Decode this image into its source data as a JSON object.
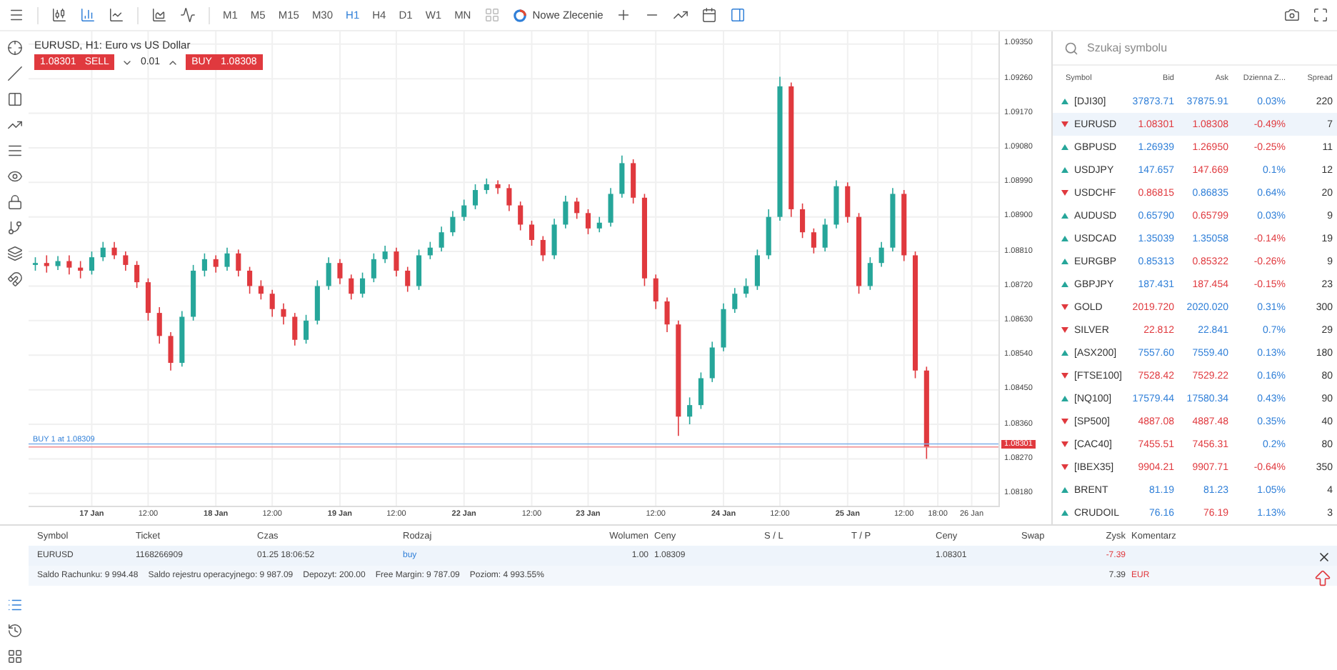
{
  "toolbar": {
    "timeframes": [
      {
        "label": "M1",
        "selected": false
      },
      {
        "label": "M5",
        "selected": false
      },
      {
        "label": "M15",
        "selected": false
      },
      {
        "label": "M30",
        "selected": false
      },
      {
        "label": "H1",
        "selected": true
      },
      {
        "label": "H4",
        "selected": false
      },
      {
        "label": "D1",
        "selected": false
      },
      {
        "label": "W1",
        "selected": false
      },
      {
        "label": "MN",
        "selected": false
      }
    ],
    "new_order": "Nowe Zlecenie"
  },
  "chart": {
    "title": "EURUSD, H1: Euro vs US Dollar",
    "sell": {
      "price": "1.08301",
      "label": "SELL"
    },
    "lot": "0.01",
    "buy": {
      "label": "BUY",
      "price": "1.08308"
    },
    "order_line": "BUY 1 at 1.08309",
    "current_price": "1.08301",
    "chart_data": {
      "type": "candlestick",
      "categories": [
        null,
        null,
        null,
        null,
        null,
        "17 Jan",
        null,
        null,
        null,
        null,
        "12:00",
        null,
        null,
        null,
        null,
        null,
        "18 Jan",
        null,
        null,
        null,
        null,
        "12:00",
        null,
        null,
        null,
        null,
        null,
        "19 Jan",
        null,
        null,
        null,
        null,
        "12:00",
        null,
        null,
        null,
        null,
        null,
        "22 Jan",
        null,
        null,
        null,
        null,
        null,
        "12:00",
        null,
        null,
        null,
        null,
        "23 Jan",
        null,
        null,
        null,
        null,
        null,
        "12:00",
        null,
        null,
        null,
        null,
        null,
        "24 Jan",
        null,
        null,
        null,
        null,
        "12:00",
        null,
        null,
        null,
        null,
        null,
        "25 Jan",
        null,
        null,
        null,
        null,
        "12:00",
        null,
        null,
        "18:00",
        null,
        null,
        "26 Jan"
      ],
      "ohlc": [
        [
          1.08775,
          1.08795,
          1.0876,
          1.0878
        ],
        [
          1.0878,
          1.088,
          1.08755,
          1.08772
        ],
        [
          1.08772,
          1.08798,
          1.08762,
          1.08785
        ],
        [
          1.08785,
          1.088,
          1.0875,
          1.08768
        ],
        [
          1.08768,
          1.08785,
          1.0874,
          1.0876
        ],
        [
          1.0876,
          1.0881,
          1.0875,
          1.08795
        ],
        [
          1.08795,
          1.08835,
          1.08785,
          1.0882
        ],
        [
          1.0882,
          1.08835,
          1.0879,
          1.088
        ],
        [
          1.088,
          1.0881,
          1.0876,
          1.08775
        ],
        [
          1.08775,
          1.08785,
          1.08715,
          1.0873
        ],
        [
          1.0873,
          1.0874,
          1.0863,
          1.0865
        ],
        [
          1.0865,
          1.08665,
          1.0857,
          1.0859
        ],
        [
          1.0859,
          1.086,
          1.085,
          1.0852
        ],
        [
          1.0852,
          1.08655,
          1.0851,
          1.0864
        ],
        [
          1.0864,
          1.08775,
          1.0863,
          1.0876
        ],
        [
          1.0876,
          1.08805,
          1.08745,
          1.0879
        ],
        [
          1.0879,
          1.088,
          1.08755,
          1.0877
        ],
        [
          1.0877,
          1.0882,
          1.0876,
          1.08805
        ],
        [
          1.08805,
          1.08815,
          1.08745,
          1.0876
        ],
        [
          1.0876,
          1.0877,
          1.087,
          1.0872
        ],
        [
          1.0872,
          1.08735,
          1.08685,
          1.087
        ],
        [
          1.087,
          1.0871,
          1.0864,
          1.0866
        ],
        [
          1.0866,
          1.08675,
          1.0862,
          1.0864
        ],
        [
          1.0864,
          1.0865,
          1.08565,
          1.0858
        ],
        [
          1.0858,
          1.08645,
          1.0857,
          1.0863
        ],
        [
          1.0863,
          1.08735,
          1.0862,
          1.0872
        ],
        [
          1.0872,
          1.08795,
          1.0871,
          1.0878
        ],
        [
          1.0878,
          1.0879,
          1.08725,
          1.0874
        ],
        [
          1.0874,
          1.0875,
          1.08685,
          1.087
        ],
        [
          1.087,
          1.08755,
          1.0869,
          1.0874
        ],
        [
          1.0874,
          1.08805,
          1.0873,
          1.0879
        ],
        [
          1.0879,
          1.08825,
          1.0878,
          1.0881
        ],
        [
          1.0881,
          1.0882,
          1.08745,
          1.0876
        ],
        [
          1.0876,
          1.0877,
          1.08705,
          1.0872
        ],
        [
          1.0872,
          1.08815,
          1.0871,
          1.088
        ],
        [
          1.088,
          1.08835,
          1.0879,
          1.0882
        ],
        [
          1.0882,
          1.08875,
          1.0881,
          1.0886
        ],
        [
          1.0886,
          1.08915,
          1.0885,
          1.089
        ],
        [
          1.089,
          1.08945,
          1.0889,
          1.0893
        ],
        [
          1.0893,
          1.08985,
          1.0892,
          1.0897
        ],
        [
          1.0897,
          1.09,
          1.0896,
          1.08985
        ],
        [
          1.08985,
          1.08995,
          1.0896,
          1.08975
        ],
        [
          1.08975,
          1.08985,
          1.08915,
          1.0893
        ],
        [
          1.0893,
          1.0894,
          1.08865,
          1.0888
        ],
        [
          1.0888,
          1.0889,
          1.08825,
          1.0884
        ],
        [
          1.0884,
          1.0885,
          1.08785,
          1.088
        ],
        [
          1.088,
          1.08895,
          1.0879,
          1.0888
        ],
        [
          1.0888,
          1.08955,
          1.0887,
          1.0894
        ],
        [
          1.0894,
          1.0895,
          1.08895,
          1.0891
        ],
        [
          1.0891,
          1.0892,
          1.08855,
          1.0887
        ],
        [
          1.0887,
          1.089,
          1.0886,
          1.08885
        ],
        [
          1.08885,
          1.08975,
          1.08875,
          1.0896
        ],
        [
          1.0896,
          1.0906,
          1.0895,
          1.0904
        ],
        [
          1.0904,
          1.0905,
          1.08935,
          1.0895
        ],
        [
          1.0895,
          1.0896,
          1.0872,
          1.0874
        ],
        [
          1.0874,
          1.0875,
          1.0866,
          1.0868
        ],
        [
          1.0868,
          1.0869,
          1.086,
          1.0862
        ],
        [
          1.0862,
          1.0863,
          1.0833,
          1.0838
        ],
        [
          1.0838,
          1.0843,
          1.0836,
          1.0841
        ],
        [
          1.0841,
          1.08495,
          1.084,
          1.0848
        ],
        [
          1.0848,
          1.08575,
          1.0847,
          1.0856
        ],
        [
          1.0856,
          1.08675,
          1.0855,
          1.0866
        ],
        [
          1.0866,
          1.08715,
          1.0865,
          1.087
        ],
        [
          1.087,
          1.0874,
          1.0869,
          1.0872
        ],
        [
          1.0872,
          1.08815,
          1.0871,
          1.088
        ],
        [
          1.088,
          1.0892,
          1.0879,
          1.089
        ],
        [
          1.089,
          1.09265,
          1.0889,
          1.0924
        ],
        [
          1.0924,
          1.0925,
          1.089,
          1.0892
        ],
        [
          1.0892,
          1.08935,
          1.08845,
          1.0886
        ],
        [
          1.0886,
          1.0887,
          1.08805,
          1.0882
        ],
        [
          1.0882,
          1.08895,
          1.0881,
          1.0888
        ],
        [
          1.0888,
          1.08995,
          1.0887,
          1.0898
        ],
        [
          1.0898,
          1.0899,
          1.08885,
          1.089
        ],
        [
          1.089,
          1.0891,
          1.087,
          1.0872
        ],
        [
          1.0872,
          1.08795,
          1.0871,
          1.0878
        ],
        [
          1.0878,
          1.08835,
          1.0877,
          1.0882
        ],
        [
          1.0882,
          1.08975,
          1.0881,
          1.0896
        ],
        [
          1.0896,
          1.0897,
          1.08785,
          1.088
        ],
        [
          1.088,
          1.0881,
          1.0848,
          1.085
        ],
        [
          1.085,
          1.0851,
          1.0827,
          1.083
        ],
        null,
        null,
        null,
        null
      ],
      "grid": true,
      "ref_lines": [
        {
          "axis": "y",
          "value": 1.08309,
          "color": "#7fb0ea"
        },
        {
          "axis": "y",
          "value": 1.08301,
          "color": "#f08a8d"
        }
      ],
      "ylim": [
        1.08148,
        1.09383
      ],
      "yticks": [
        {
          "value": 1.0935,
          "label": "1.09350"
        },
        {
          "value": 1.0926,
          "label": "1.09260"
        },
        {
          "value": 1.0917,
          "label": "1.09170"
        },
        {
          "value": 1.0908,
          "label": "1.09080"
        },
        {
          "value": 1.0899,
          "label": "1.08990"
        },
        {
          "value": 1.089,
          "label": "1.08900"
        },
        {
          "value": 1.0881,
          "label": "1.08810"
        },
        {
          "value": 1.0872,
          "label": "1.08720"
        },
        {
          "value": 1.0863,
          "label": "1.08630"
        },
        {
          "value": 1.0854,
          "label": "1.08540"
        },
        {
          "value": 1.0845,
          "label": "1.08450"
        },
        {
          "value": 1.0836,
          "label": "1.08360"
        },
        {
          "value": 1.0827,
          "label": "1.08270"
        },
        {
          "value": 1.0818,
          "label": "1.08180"
        }
      ]
    }
  },
  "watchlist": {
    "placeholder": "Szukaj symbolu",
    "columns": [
      "Symbol",
      "Bid",
      "Ask",
      "Dzienna Z...",
      "Spread"
    ],
    "rows": [
      {
        "symbol": "[DJI30]",
        "up": true,
        "bid": "37873.71",
        "bid_up": true,
        "ask": "37875.91",
        "ask_up": true,
        "change": "0.03%",
        "change_up": true,
        "spread": "220",
        "selected": false
      },
      {
        "symbol": "EURUSD",
        "up": false,
        "bid": "1.08301",
        "bid_up": false,
        "ask": "1.08308",
        "ask_up": false,
        "change": "-0.49%",
        "change_up": false,
        "spread": "7",
        "selected": true
      },
      {
        "symbol": "GBPUSD",
        "up": true,
        "bid": "1.26939",
        "bid_up": true,
        "ask": "1.26950",
        "ask_up": false,
        "change": "-0.25%",
        "change_up": false,
        "spread": "11",
        "selected": false
      },
      {
        "symbol": "USDJPY",
        "up": true,
        "bid": "147.657",
        "bid_up": true,
        "ask": "147.669",
        "ask_up": false,
        "change": "0.1%",
        "change_up": true,
        "spread": "12",
        "selected": false
      },
      {
        "symbol": "USDCHF",
        "up": false,
        "bid": "0.86815",
        "bid_up": false,
        "ask": "0.86835",
        "ask_up": true,
        "change": "0.64%",
        "change_up": true,
        "spread": "20",
        "selected": false
      },
      {
        "symbol": "AUDUSD",
        "up": true,
        "bid": "0.65790",
        "bid_up": true,
        "ask": "0.65799",
        "ask_up": false,
        "change": "0.03%",
        "change_up": true,
        "spread": "9",
        "selected": false
      },
      {
        "symbol": "USDCAD",
        "up": true,
        "bid": "1.35039",
        "bid_up": true,
        "ask": "1.35058",
        "ask_up": true,
        "change": "-0.14%",
        "change_up": false,
        "spread": "19",
        "selected": false
      },
      {
        "symbol": "EURGBP",
        "up": true,
        "bid": "0.85313",
        "bid_up": true,
        "ask": "0.85322",
        "ask_up": false,
        "change": "-0.26%",
        "change_up": false,
        "spread": "9",
        "selected": false
      },
      {
        "symbol": "GBPJPY",
        "up": true,
        "bid": "187.431",
        "bid_up": true,
        "ask": "187.454",
        "ask_up": false,
        "change": "-0.15%",
        "change_up": false,
        "spread": "23",
        "selected": false
      },
      {
        "symbol": "GOLD",
        "up": false,
        "bid": "2019.720",
        "bid_up": false,
        "ask": "2020.020",
        "ask_up": true,
        "change": "0.31%",
        "change_up": true,
        "spread": "300",
        "selected": false
      },
      {
        "symbol": "SILVER",
        "up": false,
        "bid": "22.812",
        "bid_up": false,
        "ask": "22.841",
        "ask_up": true,
        "change": "0.7%",
        "change_up": true,
        "spread": "29",
        "selected": false
      },
      {
        "symbol": "[ASX200]",
        "up": true,
        "bid": "7557.60",
        "bid_up": true,
        "ask": "7559.40",
        "ask_up": true,
        "change": "0.13%",
        "change_up": true,
        "spread": "180",
        "selected": false
      },
      {
        "symbol": "[FTSE100]",
        "up": false,
        "bid": "7528.42",
        "bid_up": false,
        "ask": "7529.22",
        "ask_up": false,
        "change": "0.16%",
        "change_up": true,
        "spread": "80",
        "selected": false
      },
      {
        "symbol": "[NQ100]",
        "up": true,
        "bid": "17579.44",
        "bid_up": true,
        "ask": "17580.34",
        "ask_up": true,
        "change": "0.43%",
        "change_up": true,
        "spread": "90",
        "selected": false
      },
      {
        "symbol": "[SP500]",
        "up": false,
        "bid": "4887.08",
        "bid_up": false,
        "ask": "4887.48",
        "ask_up": false,
        "change": "0.35%",
        "change_up": true,
        "spread": "40",
        "selected": false
      },
      {
        "symbol": "[CAC40]",
        "up": false,
        "bid": "7455.51",
        "bid_up": false,
        "ask": "7456.31",
        "ask_up": false,
        "change": "0.2%",
        "change_up": true,
        "spread": "80",
        "selected": false
      },
      {
        "symbol": "[IBEX35]",
        "up": false,
        "bid": "9904.21",
        "bid_up": false,
        "ask": "9907.71",
        "ask_up": false,
        "change": "-0.64%",
        "change_up": false,
        "spread": "350",
        "selected": false
      },
      {
        "symbol": "BRENT",
        "up": true,
        "bid": "81.19",
        "bid_up": true,
        "ask": "81.23",
        "ask_up": true,
        "change": "1.05%",
        "change_up": true,
        "spread": "4",
        "selected": false
      },
      {
        "symbol": "CRUDOIL",
        "up": true,
        "bid": "76.16",
        "bid_up": true,
        "ask": "76.19",
        "ask_up": false,
        "change": "1.13%",
        "change_up": true,
        "spread": "3",
        "selected": false
      }
    ]
  },
  "positions": {
    "columns": [
      "Symbol",
      "Ticket",
      "Czas",
      "Rodzaj",
      "Wolumen",
      "Ceny",
      "S / L",
      "T / P",
      "Ceny",
      "Swap",
      "Zysk",
      "Komentarz"
    ],
    "rows": [
      {
        "symbol": "EURUSD",
        "ticket": "1168266909",
        "time": "01.25 18:06:52",
        "type": "buy",
        "volume": "1.00",
        "open_price": "1.08309",
        "price": "1.08301",
        "profit": "-7.39"
      }
    ],
    "summary": {
      "items": [
        "Saldo Rachunku: 9 994.48",
        "Saldo rejestru operacyjnego: 9 987.09",
        "Depozyt: 200.00",
        "Free Margin: 9 787.09",
        "Poziom: 4 993.55%"
      ],
      "profit": "7.39",
      "currency": "EUR"
    }
  }
}
